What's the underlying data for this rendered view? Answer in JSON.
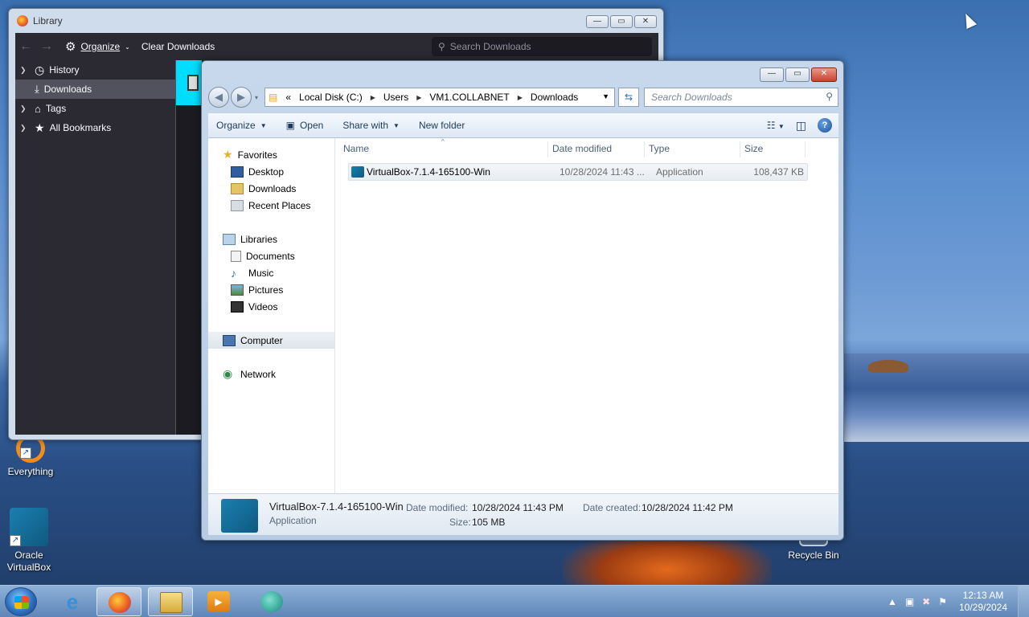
{
  "desktop": {
    "icons": [
      {
        "label": "Everything"
      },
      {
        "label": "Oracle VirtualBox"
      },
      {
        "label": "Recycle Bin"
      }
    ]
  },
  "library": {
    "title": "Library",
    "toolbar": {
      "organize": "Organize",
      "clear": "Clear Downloads",
      "search_placeholder": "Search Downloads"
    },
    "tree": [
      {
        "label": "History",
        "icon": "clock-icon"
      },
      {
        "label": "Downloads",
        "icon": "download-icon",
        "selected": true
      },
      {
        "label": "Tags",
        "icon": "tag-icon"
      },
      {
        "label": "All Bookmarks",
        "icon": "star-icon"
      }
    ]
  },
  "explorer": {
    "breadcrumb": [
      "«",
      "Local Disk (C:)",
      "Users",
      "VM1.COLLABNET",
      "Downloads"
    ],
    "search_placeholder": "Search Downloads",
    "commands": {
      "organize": "Organize",
      "open": "Open",
      "share": "Share with",
      "new_folder": "New folder"
    },
    "nav": {
      "favorites": "Favorites",
      "desktop": "Desktop",
      "downloads": "Downloads",
      "recent": "Recent Places",
      "libraries": "Libraries",
      "documents": "Documents",
      "music": "Music",
      "pictures": "Pictures",
      "videos": "Videos",
      "computer": "Computer",
      "network": "Network"
    },
    "columns": {
      "name": "Name",
      "date": "Date modified",
      "type": "Type",
      "size": "Size"
    },
    "files": [
      {
        "name": "VirtualBox-7.1.4-165100-Win",
        "date": "10/28/2024 11:43 ...",
        "type": "Application",
        "size": "108,437 KB"
      }
    ],
    "details": {
      "name": "VirtualBox-7.1.4-165100-Win",
      "type": "Application",
      "modified_label": "Date modified:",
      "modified": "10/28/2024 11:43 PM",
      "created_label": "Date created:",
      "created": "10/28/2024 11:42 PM",
      "size_label": "Size:",
      "size": "105 MB"
    }
  },
  "taskbar": {
    "time": "12:13 AM",
    "date": "10/29/2024",
    "apps": [
      "internet-explorer-icon",
      "firefox-icon",
      "file-explorer-icon",
      "media-player-icon",
      "chat-app-icon"
    ]
  }
}
